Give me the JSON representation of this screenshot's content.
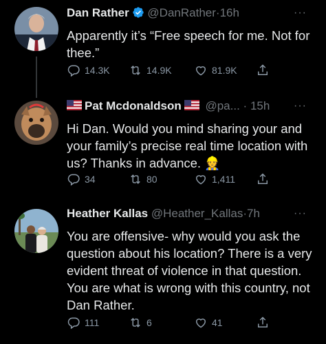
{
  "tweets": [
    {
      "name": "Dan Rather",
      "handle": "@DanRather",
      "dot": "·",
      "time": "16h",
      "text": "Apparently it’s “Free speech for me. Not for thee.”",
      "replies": "14.3K",
      "retweets": "14.9K",
      "likes": "81.9K"
    },
    {
      "name": "Pat Mcdonaldson",
      "handle": "@pa...",
      "dot": "·",
      "time": "15h",
      "text": "Hi Dan. Would you mind sharing your and your family’s precise real time location with us? Thanks in advance. ",
      "emoji": "👷",
      "replies": "34",
      "retweets": "80",
      "likes": "1,411"
    },
    {
      "name": "Heather Kallas",
      "handle": "@Heather_Kallas",
      "dot": "·",
      "time": "7h",
      "text": "You are offensive- why would you ask the question about his location? There is a very evident threat of violence in that question. You are what is wrong with this country, not Dan Rather.",
      "replies": "111",
      "retweets": "6",
      "likes": "41"
    }
  ],
  "more_label": "···",
  "colors": {
    "background": "#000000",
    "text": "#e7e9ea",
    "muted": "#71767b",
    "verified": "#1d9bf0"
  },
  "icons": [
    "verified-badge-icon",
    "us-flag-icon",
    "reply-icon",
    "retweet-icon",
    "like-icon",
    "share-icon",
    "more-icon"
  ]
}
